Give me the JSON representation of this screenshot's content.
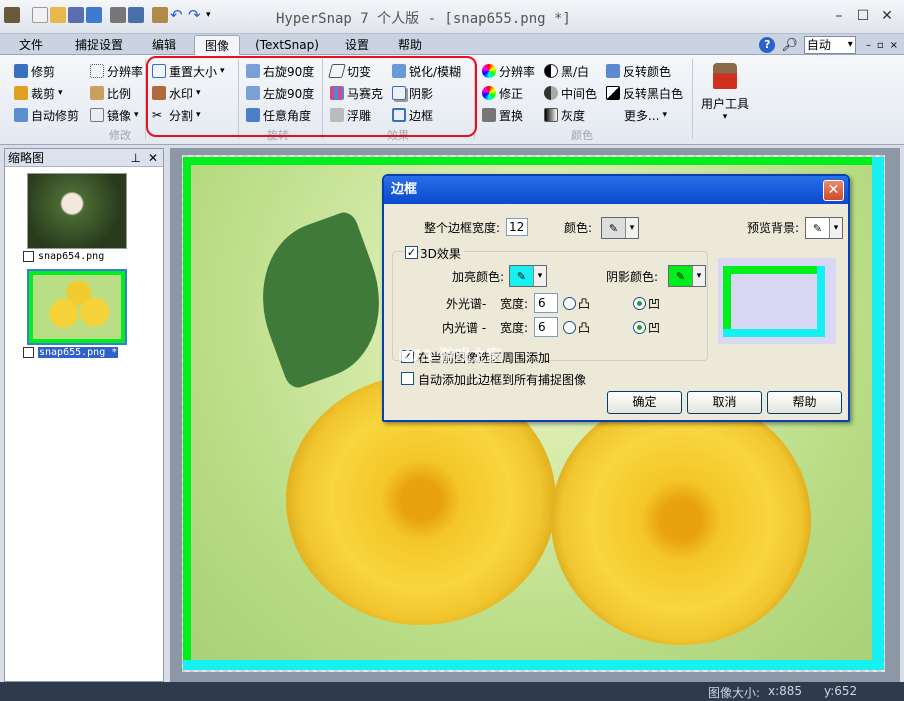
{
  "window": {
    "title": "HyperSnap 7 个人版 - [snap655.png *]"
  },
  "menu": {
    "tabs": [
      "文件",
      "捕捉设置",
      "编辑",
      "图像",
      "(TextSnap)",
      "设置",
      "帮助"
    ],
    "active": "图像",
    "zoom_value": "自动"
  },
  "ribbon": {
    "g1": {
      "crop": "修剪",
      "resolution": "分辨率",
      "cut": "裁剪",
      "scale": "比例",
      "auto_crop": "自动修剪",
      "mirror": "镜像",
      "label": "修改"
    },
    "g2": {
      "resize": "重置大小",
      "watermark": "水印",
      "split": "分割"
    },
    "g3": {
      "rot_right": "右旋90度",
      "rot_left": "左旋90度",
      "rot_any": "任意角度",
      "label": "旋转"
    },
    "g4": {
      "shear": "切变",
      "sharpen": "锐化/模糊",
      "mosaic": "马赛克",
      "shadow": "阴影",
      "emboss": "浮雕",
      "border": "边框",
      "label": "效果"
    },
    "g5": {
      "res": "分辨率",
      "bw": "黑/白",
      "invert": "反转颜色",
      "correct": "修正",
      "midtone": "中间色",
      "invert_bw": "反转黑白色",
      "replace": "置换",
      "gray": "灰度",
      "more": "更多...",
      "label": "颜色"
    },
    "user_tools": "用户工具"
  },
  "panel": {
    "title": "缩略图",
    "thumbs": [
      "snap654.png",
      "snap655.png *"
    ]
  },
  "dialog": {
    "title": "边框",
    "total_width_label": "整个边框宽度:",
    "total_width": "12",
    "color_label": "颜色:",
    "preview_bg_label": "预览背景:",
    "effect3d_label": "3D效果",
    "highlight_label": "加亮颜色:",
    "shadow_label": "阴影颜色:",
    "outer_label": "外光谱-",
    "inner_label": "内光谱 -",
    "width_label": "宽度:",
    "outer_width": "6",
    "inner_width": "6",
    "convex": "凸",
    "concave": "凹",
    "add_around_label": "在当前图像选区周围添加",
    "auto_add_label": "自动添加此边框到所有捕捉图像",
    "ok": "确定",
    "cancel": "取消",
    "help": "帮助",
    "watermark": "K73 游戏之家"
  },
  "status": {
    "image_size": "图像大小:",
    "x": "x:885",
    "y": "y:652"
  },
  "colors": {
    "accent": "#0a49cf",
    "highlight_box": "#e8101a",
    "border_green": "#00ee1b",
    "border_cyan": "#16f0f0"
  }
}
